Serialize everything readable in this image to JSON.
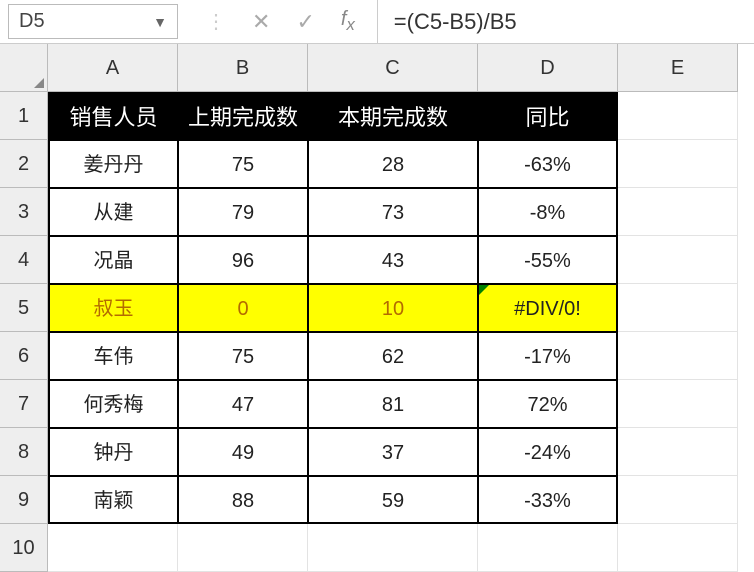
{
  "name_box": {
    "value": "D5"
  },
  "formula_bar": {
    "formula": "=(C5-B5)/B5"
  },
  "column_headers": [
    "A",
    "B",
    "C",
    "D",
    "E"
  ],
  "row_headers": [
    "1",
    "2",
    "3",
    "4",
    "5",
    "6",
    "7",
    "8",
    "9",
    "10"
  ],
  "table": {
    "headers": [
      "销售人员",
      "上期完成数",
      "本期完成数",
      "同比"
    ],
    "rows": [
      {
        "a": "姜丹丹",
        "b": "75",
        "c": "28",
        "d": "-63%"
      },
      {
        "a": "从建",
        "b": "79",
        "c": "73",
        "d": "-8%"
      },
      {
        "a": "况晶",
        "b": "96",
        "c": "43",
        "d": "-55%"
      },
      {
        "a": "叔玉",
        "b": "0",
        "c": "10",
        "d": "#DIV/0!"
      },
      {
        "a": "车伟",
        "b": "75",
        "c": "62",
        "d": "-17%"
      },
      {
        "a": "何秀梅",
        "b": "47",
        "c": "81",
        "d": "72%"
      },
      {
        "a": "钟丹",
        "b": "49",
        "c": "37",
        "d": "-24%"
      },
      {
        "a": "南颖",
        "b": "88",
        "c": "59",
        "d": "-33%"
      }
    ],
    "highlighted_row_index": 3
  }
}
